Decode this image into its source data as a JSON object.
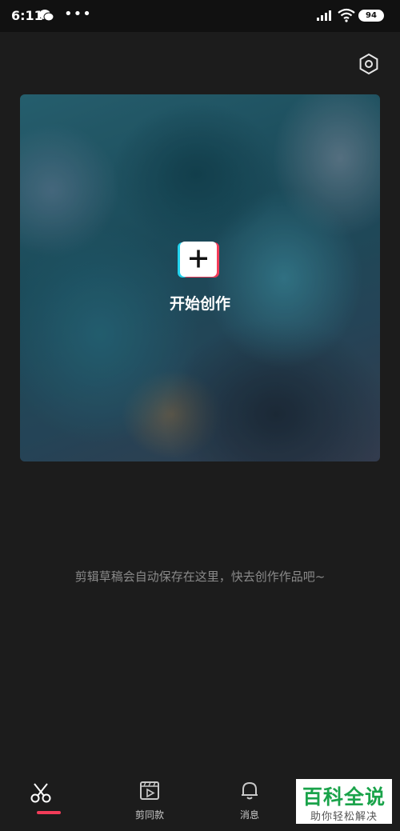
{
  "status_bar": {
    "time": "6:11",
    "battery": "94"
  },
  "hero": {
    "create_label": "开始创作"
  },
  "empty_hint": "剪辑草稿会自动保存在这里，快去创作作品吧~",
  "tabs": [
    {
      "label": "",
      "icon": "scissors-icon",
      "active": true
    },
    {
      "label": "剪同款",
      "icon": "template-icon",
      "active": false
    },
    {
      "label": "消息",
      "icon": "bell-icon",
      "active": false
    }
  ],
  "watermark": {
    "title": "百科全说",
    "subtitle": "助你轻松解决"
  },
  "colors": {
    "background": "#1c1c1c",
    "accent": "#f23c59",
    "hint_text": "#8a8a8a"
  }
}
